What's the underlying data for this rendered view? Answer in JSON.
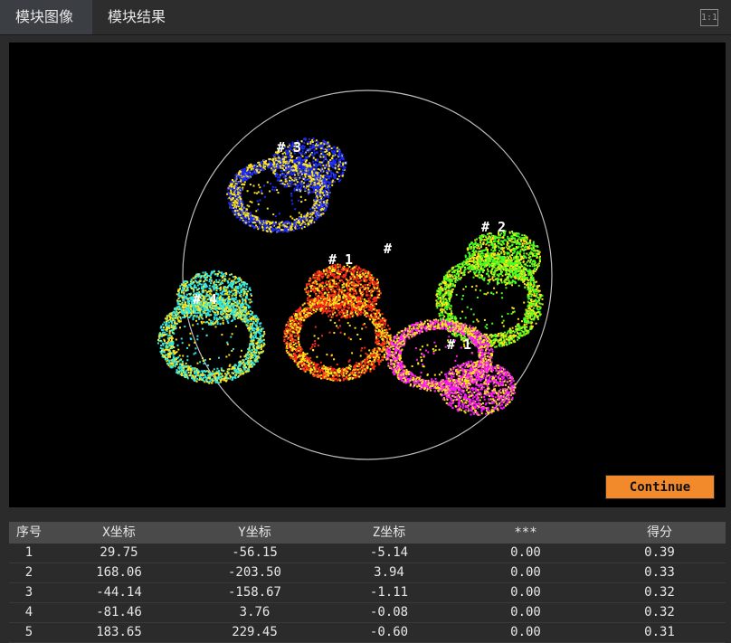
{
  "tabs": [
    {
      "label": "模块图像",
      "active": true
    },
    {
      "label": "模块结果",
      "active": false
    }
  ],
  "fit_button": "1:1",
  "viewer": {
    "continue_label": "Continue",
    "part_labels": [
      "# 1",
      "# 2",
      "# 3",
      "# 4",
      "#",
      "# 1"
    ],
    "colors": {
      "red": "#ff2a1a",
      "green": "#44ff22",
      "blue": "#1c2bff",
      "cyan": "#2ee8e8",
      "magenta": "#ff1aff",
      "yellow": "#ffe61a"
    }
  },
  "table": {
    "headers": [
      "序号",
      "X坐标",
      "Y坐标",
      "Z坐标",
      "***",
      "得分"
    ],
    "rows": [
      [
        "1",
        "29.75",
        "-56.15",
        "-5.14",
        "0.00",
        "0.39"
      ],
      [
        "2",
        "168.06",
        "-203.50",
        "3.94",
        "0.00",
        "0.33"
      ],
      [
        "3",
        "-44.14",
        "-158.67",
        "-1.11",
        "0.00",
        "0.32"
      ],
      [
        "4",
        "-81.46",
        "3.76",
        "-0.08",
        "0.00",
        "0.32"
      ],
      [
        "5",
        "183.65",
        "229.45",
        "-0.60",
        "0.00",
        "0.31"
      ]
    ]
  }
}
